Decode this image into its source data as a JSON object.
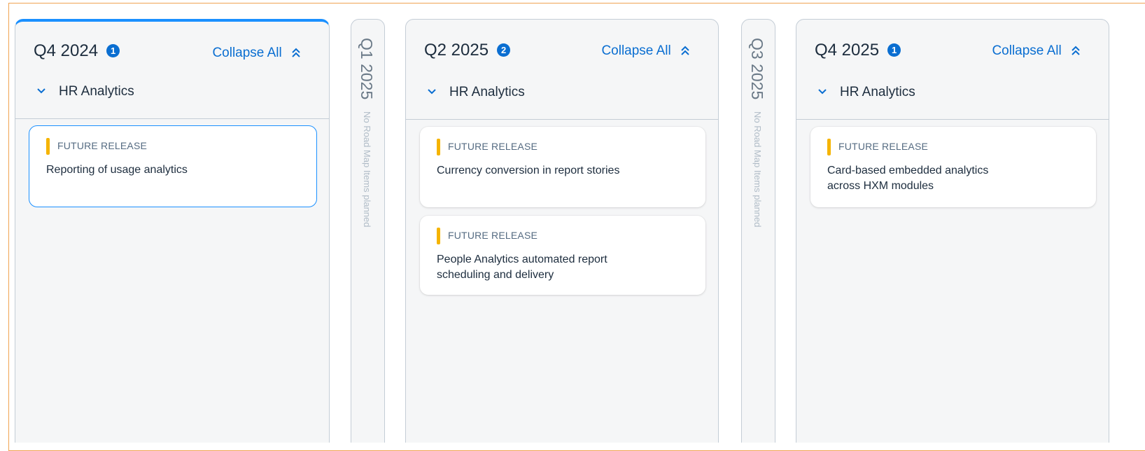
{
  "columns": [
    {
      "quarter": "Q4 2024",
      "count": "1",
      "collapse_label": "Collapse All",
      "group_label": "HR Analytics",
      "cards": [
        {
          "tag": "FUTURE RELEASE",
          "title": "Reporting of usage analytics"
        }
      ]
    },
    {
      "quarter": "Q1 2025",
      "empty_text": "No Road Map Items planned"
    },
    {
      "quarter": "Q2 2025",
      "count": "2",
      "collapse_label": "Collapse All",
      "group_label": "HR Analytics",
      "cards": [
        {
          "tag": "FUTURE RELEASE",
          "title": "Currency conversion in report stories"
        },
        {
          "tag": "FUTURE RELEASE",
          "title": "People Analytics automated report scheduling and delivery"
        }
      ]
    },
    {
      "quarter": "Q3 2025",
      "empty_text": "No Road Map Items planned"
    },
    {
      "quarter": "Q4 2025",
      "count": "1",
      "collapse_label": "Collapse All",
      "group_label": "HR Analytics",
      "cards": [
        {
          "tag": "FUTURE RELEASE",
          "title": "Card-based embedded analytics across HXM modules"
        }
      ]
    }
  ],
  "colors": {
    "accent": "#0a6ed1",
    "selected_border": "#1b90ff",
    "tag_marker": "#f5b400",
    "frame_border": "#f0a352"
  }
}
